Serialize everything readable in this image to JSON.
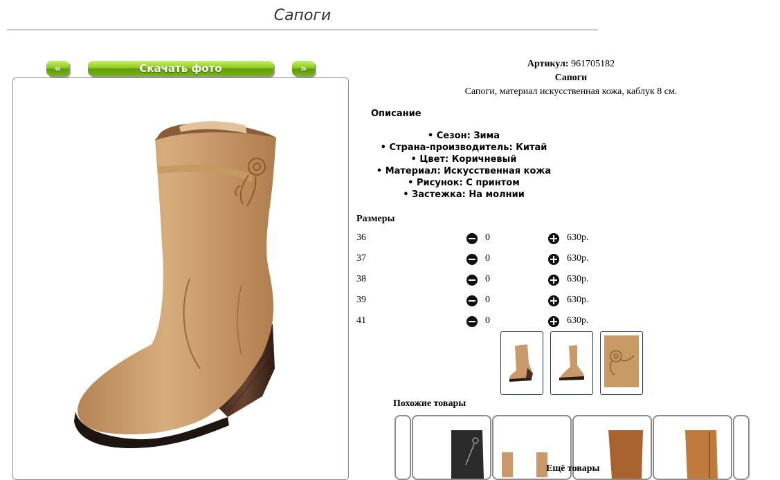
{
  "page": {
    "title": "Сапоги"
  },
  "nav": {
    "prev_label": "«",
    "download_label": "Скачать фото",
    "next_label": "»"
  },
  "product": {
    "sku_label": "Артикул:",
    "sku_value": "961705182",
    "name": "Сапоги",
    "short_description": "Сапоги, материал искусственная кожа, каблук 8 см."
  },
  "description": {
    "heading": "Описание",
    "features": [
      "Сезон: Зима",
      "Страна-производитель: Китай",
      "Цвет: Коричневый",
      "Материал: Искусственная кожа",
      "Рисунок: С принтом",
      "Застежка: На молнии"
    ]
  },
  "sizes": {
    "heading": "Размеры",
    "rows": [
      {
        "size": "36",
        "qty": "0",
        "price": "630р."
      },
      {
        "size": "37",
        "qty": "0",
        "price": "630р."
      },
      {
        "size": "38",
        "qty": "0",
        "price": "630р."
      },
      {
        "size": "39",
        "qty": "0",
        "price": "630р."
      },
      {
        "size": "41",
        "qty": "0",
        "price": "630р."
      }
    ]
  },
  "icons": {
    "decrease": "minus-circle-icon",
    "increase": "plus-circle-icon"
  },
  "colors": {
    "button_green": "#8ecb1e",
    "thumb_border": "#1f3a6e",
    "boot_tan": "#c9996a"
  },
  "similar": {
    "heading": "Похожие товары",
    "more_label": "Ещё товары"
  }
}
